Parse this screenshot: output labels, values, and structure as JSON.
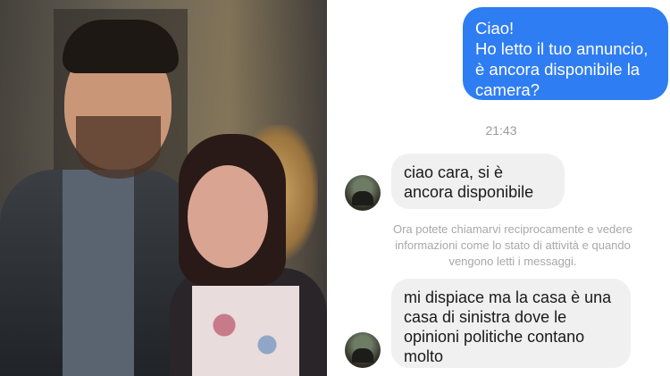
{
  "conversation": {
    "outgoing_message": "Ciao!\nHo letto il tuo annuncio, è ancora disponibile la camera?",
    "timestamp": "21:43",
    "incoming_message_1": "ciao cara, si è ancora disponibile",
    "system_notice": "Ora potete chiamarvi reciprocamente e vedere informazioni come lo stato di attività e quando vengono letti i messaggi.",
    "incoming_message_2": "mi dispiace ma la casa è una casa di sinistra dove le opinioni politiche contano molto"
  },
  "colors": {
    "outgoing_bubble": "#2f7df3",
    "incoming_bubble": "#f1f0f0",
    "muted_text": "#9b9b9b"
  }
}
